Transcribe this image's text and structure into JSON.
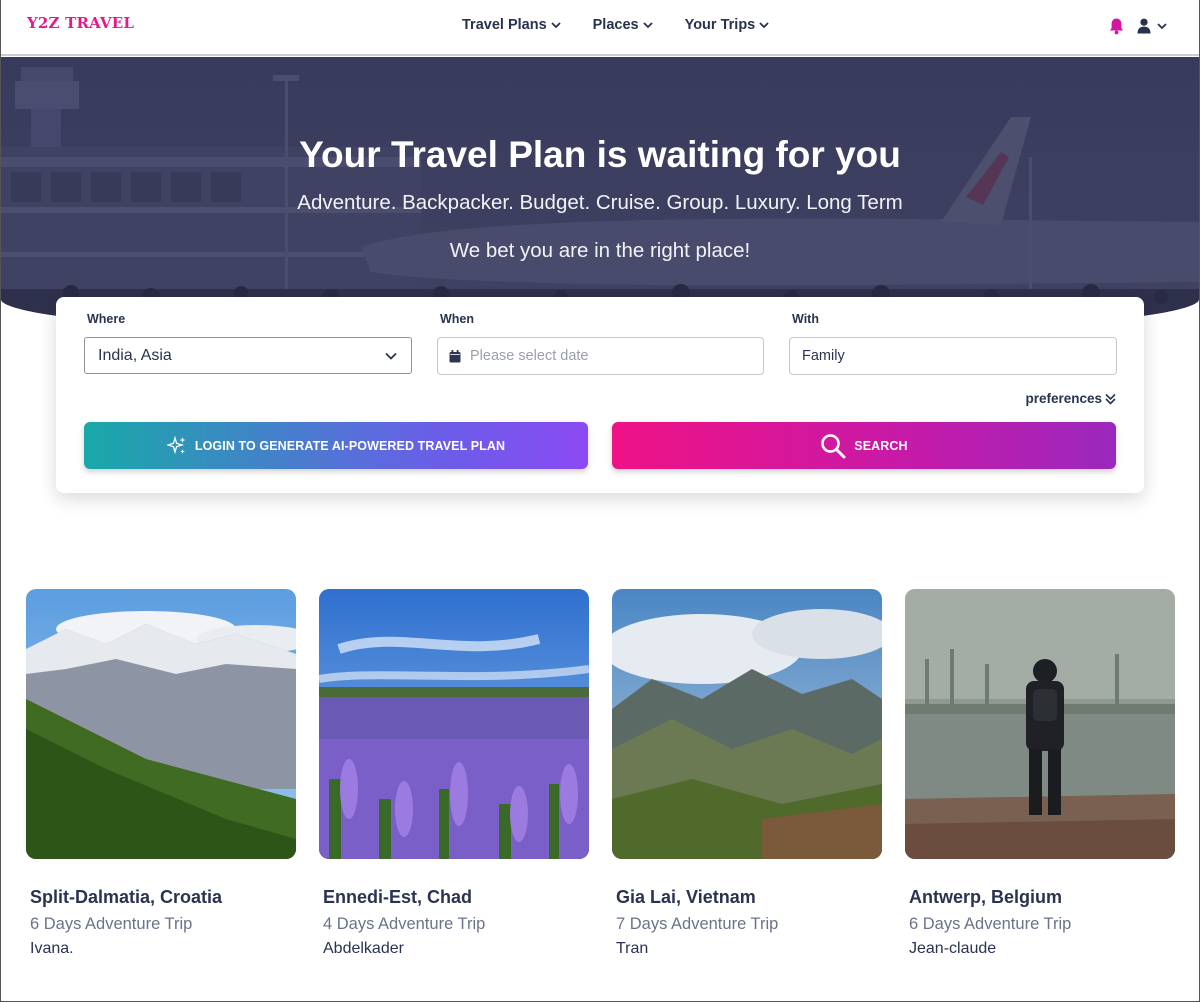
{
  "brand": {
    "logo": "Y2Z TRAVEL",
    "accent": "#e8188c"
  },
  "nav": {
    "items": [
      {
        "label": "Travel Plans"
      },
      {
        "label": "Places"
      },
      {
        "label": "Your Trips"
      }
    ],
    "icons": [
      "bell-icon",
      "user-icon",
      "chevron-down-icon"
    ]
  },
  "hero": {
    "title": "Your Travel Plan is waiting for you",
    "subtitle": "Adventure. Backpacker. Budget. Cruise. Group. Luxury. Long Term",
    "tagline": "We bet you are in the right place!"
  },
  "search": {
    "where_label": "Where",
    "where_value": "India, Asia",
    "when_label": "When",
    "when_placeholder": "Please select date",
    "with_label": "With",
    "with_value": "Family",
    "preferences_label": "preferences",
    "ai_button_label": "LOGIN TO GENERATE AI-POWERED TRAVEL PLAN",
    "search_button_label": "SEARCH"
  },
  "trips": [
    {
      "title": "Split-Dalmatia, Croatia",
      "subtitle": "6 Days Adventure Trip",
      "author": "Ivana."
    },
    {
      "title": "Ennedi-Est, Chad",
      "subtitle": "4 Days Adventure Trip",
      "author": "Abdelkader"
    },
    {
      "title": "Gia Lai, Vietnam",
      "subtitle": "7 Days Adventure Trip",
      "author": "Tran"
    },
    {
      "title": "Antwerp, Belgium",
      "subtitle": "6 Days Adventure Trip",
      "author": "Jean-claude"
    }
  ]
}
